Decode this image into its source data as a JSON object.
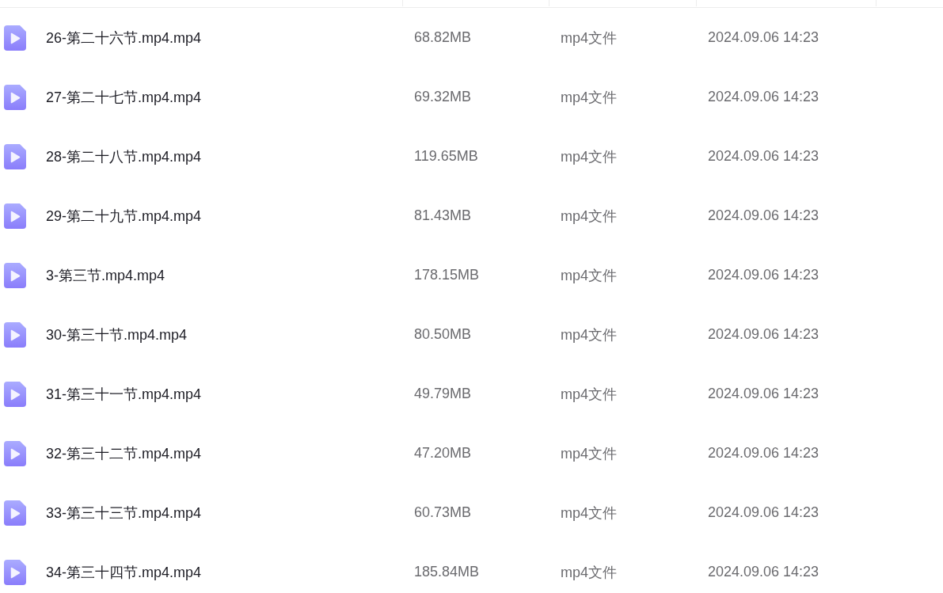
{
  "files": [
    {
      "name": "26-第二十六节.mp4.mp4",
      "size": "68.82MB",
      "type": "mp4文件",
      "modified": "2024.09.06 14:23"
    },
    {
      "name": "27-第二十七节.mp4.mp4",
      "size": "69.32MB",
      "type": "mp4文件",
      "modified": "2024.09.06 14:23"
    },
    {
      "name": "28-第二十八节.mp4.mp4",
      "size": "119.65MB",
      "type": "mp4文件",
      "modified": "2024.09.06 14:23"
    },
    {
      "name": "29-第二十九节.mp4.mp4",
      "size": "81.43MB",
      "type": "mp4文件",
      "modified": "2024.09.06 14:23"
    },
    {
      "name": "3-第三节.mp4.mp4",
      "size": "178.15MB",
      "type": "mp4文件",
      "modified": "2024.09.06 14:23"
    },
    {
      "name": "30-第三十节.mp4.mp4",
      "size": "80.50MB",
      "type": "mp4文件",
      "modified": "2024.09.06 14:23"
    },
    {
      "name": "31-第三十一节.mp4.mp4",
      "size": "49.79MB",
      "type": "mp4文件",
      "modified": "2024.09.06 14:23"
    },
    {
      "name": "32-第三十二节.mp4.mp4",
      "size": "47.20MB",
      "type": "mp4文件",
      "modified": "2024.09.06 14:23"
    },
    {
      "name": "33-第三十三节.mp4.mp4",
      "size": "60.73MB",
      "type": "mp4文件",
      "modified": "2024.09.06 14:23"
    },
    {
      "name": "34-第三十四节.mp4.mp4",
      "size": "185.84MB",
      "type": "mp4文件",
      "modified": "2024.09.06 14:23"
    }
  ]
}
